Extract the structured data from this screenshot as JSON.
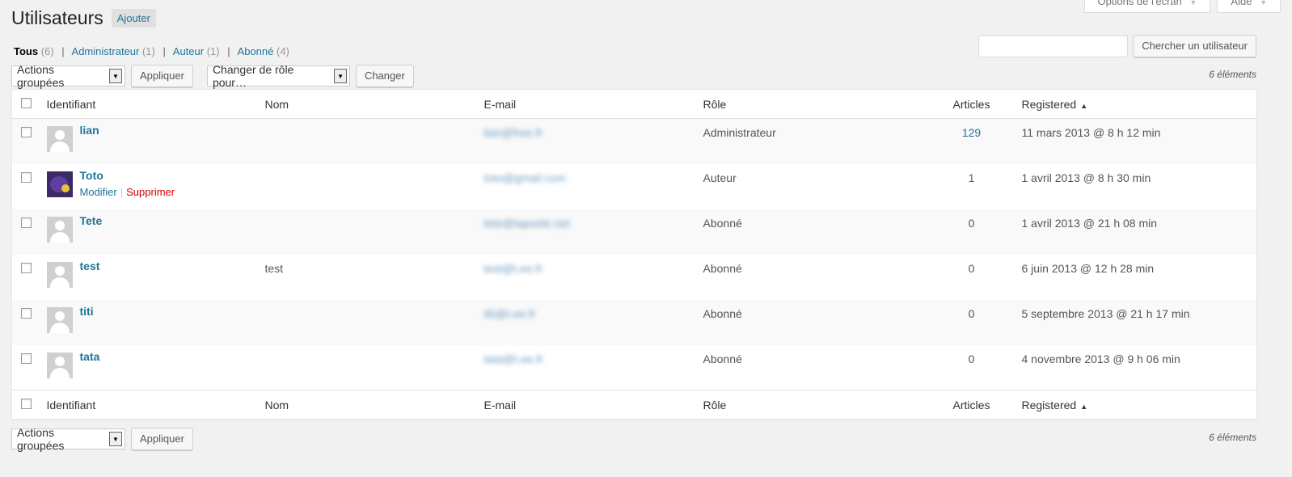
{
  "screen_meta": {
    "options_label": "Options de l'écran",
    "help_label": "Aide",
    "caret": "▼"
  },
  "page": {
    "title": "Utilisateurs",
    "add_new": "Ajouter"
  },
  "views": [
    {
      "label": "Tous",
      "count": "(6)"
    },
    {
      "label": "Administrateur",
      "count": "(1)"
    },
    {
      "label": "Auteur",
      "count": "(1)"
    },
    {
      "label": "Abonné",
      "count": "(4)"
    }
  ],
  "search": {
    "value": "",
    "button": "Chercher un utilisateur"
  },
  "tablenav_top": {
    "bulk_select": "Actions groupées",
    "apply": "Appliquer",
    "role_select": "Changer de rôle pour…",
    "change": "Changer",
    "count": "6 éléments"
  },
  "tablenav_bottom": {
    "bulk_select": "Actions groupées",
    "apply": "Appliquer",
    "count": "6 éléments"
  },
  "columns": {
    "username": "Identifiant",
    "name": "Nom",
    "email": "E-mail",
    "role": "Rôle",
    "posts": "Articles",
    "registered": "Registered",
    "sort_arrow": "▲"
  },
  "users": [
    {
      "login": "lian",
      "name": "",
      "email": "lian@free.fr",
      "role": "Administrateur",
      "posts": "129",
      "registered": "11 mars 2013 @ 8 h 12 min",
      "avatar": "default",
      "posts_link": true
    },
    {
      "login": "Toto",
      "name": "",
      "email": "toto@gmail.com",
      "role": "Auteur",
      "posts": "1",
      "registered": "1 avril 2013 @ 8 h 30 min",
      "avatar": "custom",
      "posts_link": true,
      "actions": {
        "edit": "Modifier",
        "delete": "Supprimer"
      }
    },
    {
      "login": "Tete",
      "name": "",
      "email": "tete@laposte.net",
      "role": "Abonné",
      "posts": "0",
      "registered": "1 avril 2013 @ 21 h 08 min",
      "avatar": "default",
      "posts_link": false
    },
    {
      "login": "test",
      "name": "test",
      "email": "test@t.ee.fr",
      "role": "Abonné",
      "posts": "0",
      "registered": "6 juin 2013 @ 12 h 28 min",
      "avatar": "default",
      "posts_link": false
    },
    {
      "login": "titi",
      "name": "",
      "email": "titi@t.ee.fr",
      "role": "Abonné",
      "posts": "0",
      "registered": "5 septembre 2013 @ 21 h 17 min",
      "avatar": "default",
      "posts_link": false
    },
    {
      "login": "tata",
      "name": "",
      "email": "tata@t.ee.fr",
      "role": "Abonné",
      "posts": "0",
      "registered": "4 novembre 2013 @ 9 h 06 min",
      "avatar": "default",
      "posts_link": false
    }
  ]
}
